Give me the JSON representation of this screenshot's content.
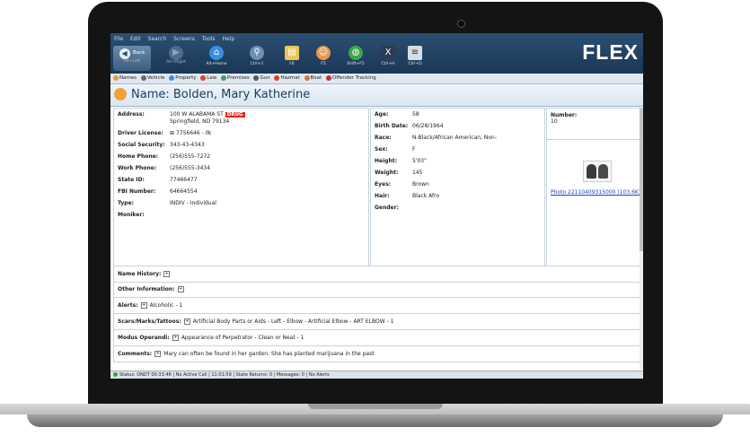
{
  "menu": [
    "File",
    "Edit",
    "Search",
    "Screens",
    "Tools",
    "Help"
  ],
  "toolbar": {
    "back_label": "Back",
    "back_sub": "Alt+Left",
    "buttons": [
      {
        "label": "Alt+Right",
        "icon": "forward-icon"
      },
      {
        "label": "Alt+Home",
        "icon": "home-icon"
      },
      {
        "label": "Ctrl+1",
        "icon": "search-icon"
      },
      {
        "label": "F6",
        "icon": "document-icon"
      },
      {
        "label": "F5",
        "icon": "person-search-icon"
      },
      {
        "label": "Shift+F5",
        "icon": "globe-icon"
      },
      {
        "label": "Ctrl+H",
        "icon": "tools-icon"
      },
      {
        "label": "Ctrl+D",
        "icon": "notepad-icon"
      }
    ]
  },
  "brand": "FLEX",
  "sections": [
    "Names",
    "Vehicle",
    "Property",
    "Law",
    "Premises",
    "Gun",
    "Hazmat",
    "Boat",
    "Offender Tracking"
  ],
  "header": {
    "title": "Name: Bolden, Mary Katherine"
  },
  "left": {
    "address_label": "Address:",
    "address_line1": "100 W ALABAMA ST",
    "drug_badge": "DRUG",
    "address_line2": "Springfield, ND 79134",
    "fields": [
      {
        "label": "Driver License:",
        "value": "⊞ 7756646 - IN"
      },
      {
        "label": "Social Security:",
        "value": "343-43-4343"
      },
      {
        "label": "Home Phone:",
        "value": "(256)555-7272"
      },
      {
        "label": "Work Phone:",
        "value": "(256)555-3434"
      },
      {
        "label": "State ID:",
        "value": "77466477"
      },
      {
        "label": "FBI Number:",
        "value": "64664554"
      },
      {
        "label": "Type:",
        "value": "INDIV - Individual"
      },
      {
        "label": "Moniker:",
        "value": ""
      }
    ]
  },
  "middle": {
    "fields": [
      {
        "label": "Age:",
        "value": "58"
      },
      {
        "label": "Birth Date:",
        "value": "06/28/1964"
      },
      {
        "label": "Race:",
        "value": "N-Black/African American, Non-"
      },
      {
        "label": "Sex:",
        "value": "F"
      },
      {
        "label": "Height:",
        "value": "5'03\""
      },
      {
        "label": "Weight:",
        "value": "145"
      },
      {
        "label": "Eyes:",
        "value": "Brown"
      },
      {
        "label": "Hair:",
        "value": "Black Afro"
      },
      {
        "label": "Gender:",
        "value": ""
      }
    ]
  },
  "right": {
    "number_label": "Number:",
    "number_value": "10",
    "photo_link": "Photo 22110409315000 (103.6K)"
  },
  "rows": [
    {
      "label": "Name History:",
      "value": ""
    },
    {
      "label": "Other Information:",
      "value": ""
    },
    {
      "label": "Alerts:",
      "value": "Alcoholic - 1"
    },
    {
      "label": "Scars/Marks/Tattoos:",
      "value": "Artificial Body Parts or Aids - Left - Elbow - Artificial Elbow - ART ELBOW - 1"
    },
    {
      "label": "Modus Operandi:",
      "value": "Appearance of Perpetrator - Clean or Neat - 1"
    },
    {
      "label": "Comments:",
      "value": "Mary can often be found in her garden. She has planted marijuana in the past"
    }
  ],
  "status": "Status: ONDT  00:33:46 | No Active Call | 11:01:59 | State Returns: 0 | Messages: 0 | No Alerts",
  "colors": {
    "titlebar": "#1b3756",
    "drug": "#e8231f",
    "link": "#1a44cc"
  }
}
